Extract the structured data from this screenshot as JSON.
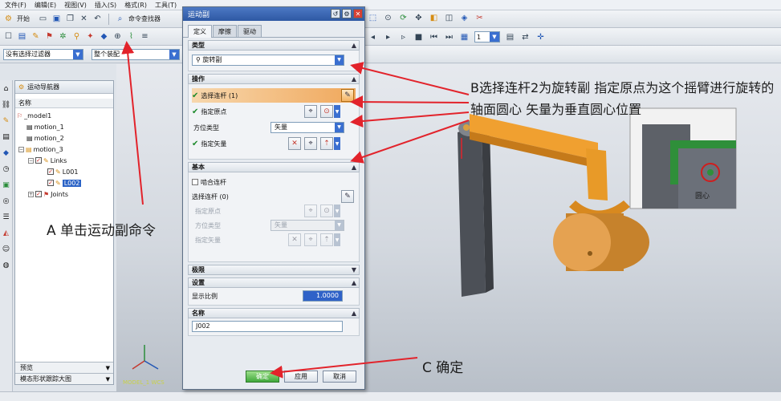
{
  "menubar": [
    "文件(F)",
    "编辑(E)",
    "视图(V)",
    "插入(S)",
    "格式(R)",
    "工具(T)"
  ],
  "toolbar": {
    "start_label": "开始",
    "command_finder": "命令查找器",
    "layer_value": "1"
  },
  "selection_bar": {
    "filter_value": "没有选择过滤器",
    "scope_value": "整个装配"
  },
  "navigator": {
    "title": "运动导航器",
    "column": "名称",
    "items": [
      {
        "label": "_model1",
        "level": 0
      },
      {
        "label": "motion_1",
        "level": 1
      },
      {
        "label": "motion_2",
        "level": 1
      },
      {
        "label": "motion_3",
        "level": 1
      },
      {
        "label": "Links",
        "level": 2
      },
      {
        "label": "L001",
        "level": 3
      },
      {
        "label": "L002",
        "level": 3
      },
      {
        "label": "Joints",
        "level": 2
      }
    ],
    "footer_preview": "预览",
    "footer_graph": "模态形状跟踪大图"
  },
  "dialog": {
    "title": "运动副",
    "tabs": [
      "定义",
      "摩擦",
      "驱动"
    ],
    "type_section": {
      "header": "类型",
      "value": "旋转副"
    },
    "operation_section": {
      "header": "操作",
      "select_link": "选择连杆 (1)",
      "specify_origin": "指定原点",
      "orient_type_label": "方位类型",
      "orient_type_value": "矢量",
      "specify_vector": "指定矢量"
    },
    "base_section": {
      "header": "基本",
      "snap_link": "啮合连杆",
      "select_link": "选择连杆 (0)",
      "specify_origin": "指定原点",
      "orient_type_label": "方位类型",
      "orient_type_value": "矢量",
      "specify_vector": "指定矢量"
    },
    "limits_header": "极限",
    "settings_section": {
      "header": "设置",
      "scale_label": "显示比例",
      "scale_value": "1.0000"
    },
    "name_section": {
      "header": "名称",
      "value": "J002"
    },
    "buttons": {
      "ok": "确定",
      "apply": "应用",
      "cancel": "取消"
    }
  },
  "viewport": {
    "inset_label": "圆心",
    "triad_label": "MODEL_1 WCS"
  },
  "annotations": {
    "a": "A 单击运动副命令",
    "b": "B选择连杆2为旋转副 指定原点为这个摇臂进行旋转的轴面圆心 矢量为垂直圆心位置",
    "c": "C 确定"
  },
  "colors": {
    "accent": "#2e58a3",
    "link_orange": "#f0a030",
    "arrow_red": "#e2232b",
    "green_part": "#2f8f3a"
  }
}
